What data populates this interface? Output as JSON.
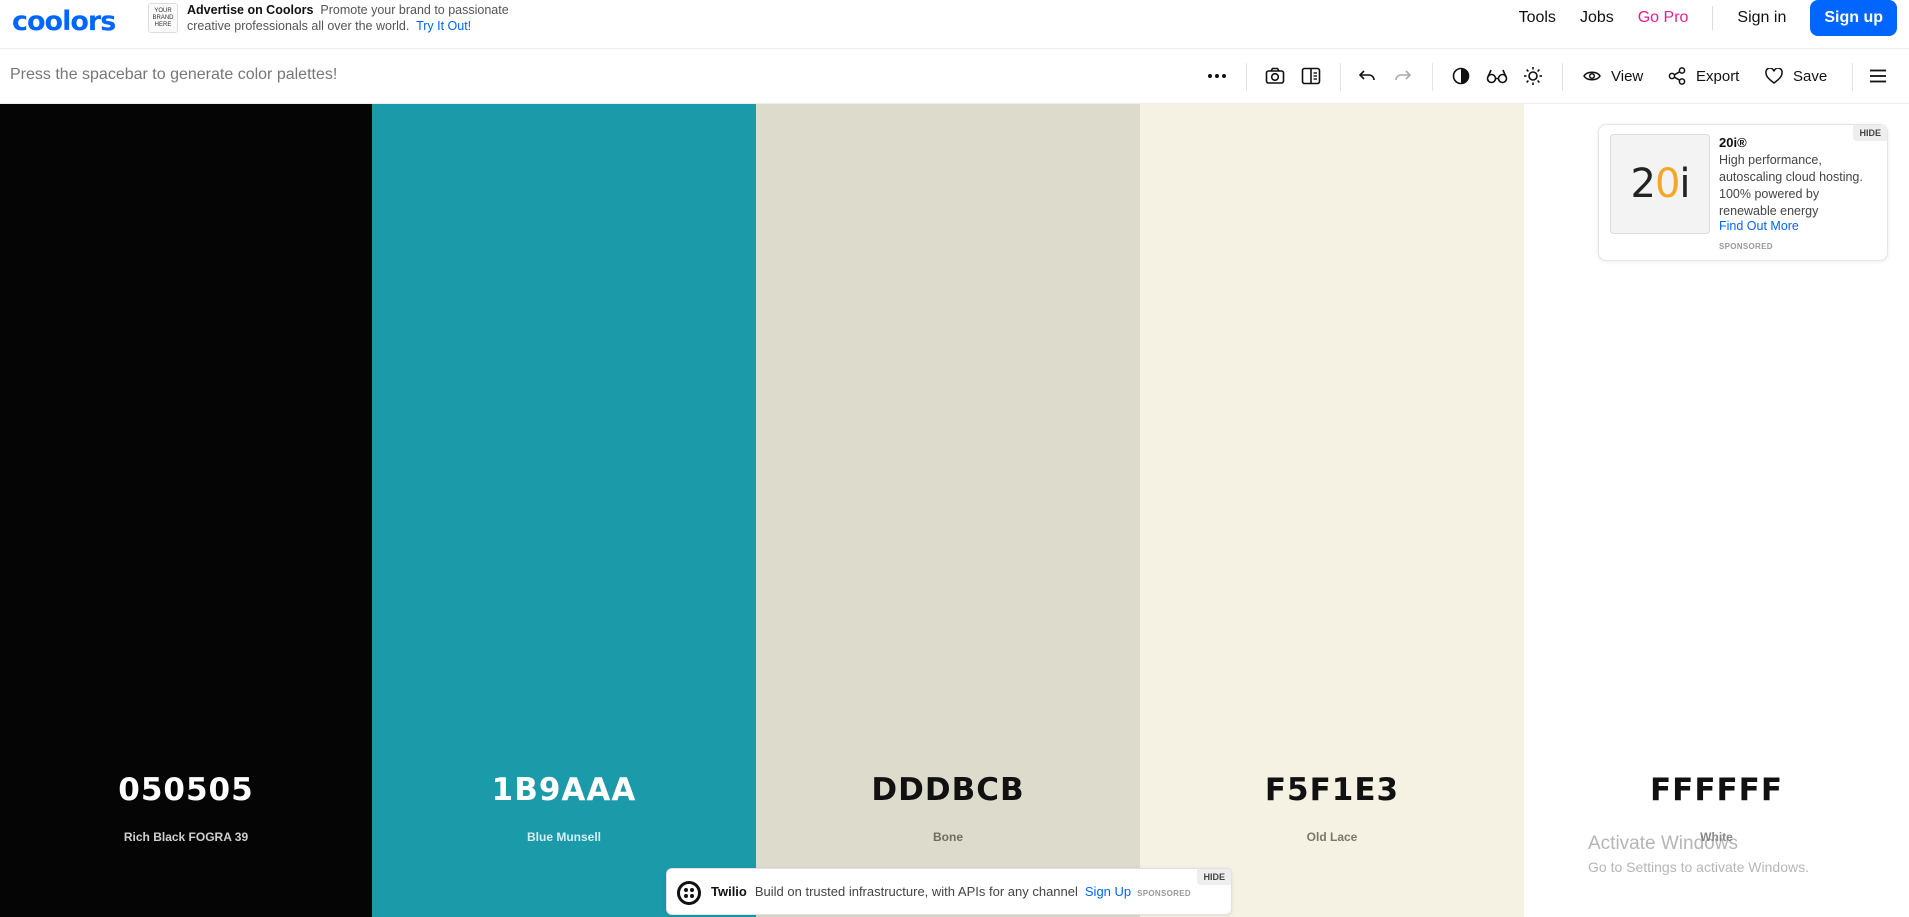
{
  "app": {
    "logo": "coolors"
  },
  "ad_top": {
    "thumb_text": "YOUR BRAND HERE",
    "title": "Advertise on Coolors",
    "body": "Promote your brand to passionate creative professionals all over the world.",
    "cta": "Try It Out!"
  },
  "nav": {
    "tools": "Tools",
    "jobs": "Jobs",
    "go_pro": "Go Pro",
    "sign_in": "Sign in",
    "sign_up": "Sign up",
    "pro_color": "#e91e8c",
    "accent": "#0066ff"
  },
  "toolbar": {
    "hint": "Press the spacebar to generate color palettes!",
    "icons": [
      "more-icon",
      "camera-icon",
      "layout-icon",
      "undo-icon",
      "redo-icon",
      "contrast-icon",
      "glasses-icon",
      "sun-icon",
      "menu-icon"
    ],
    "view": "View",
    "export": "Export",
    "save": "Save"
  },
  "palette": [
    {
      "hex": "050505",
      "name": "Rich Black FOGRA 39",
      "color": "#050505",
      "text_color": "#ffffff",
      "name_color": "#cfcfcf"
    },
    {
      "hex": "1B9AAA",
      "name": "Blue Munsell",
      "color": "#1B9AAA",
      "text_color": "#ffffff",
      "name_color": "#d6eef1"
    },
    {
      "hex": "DDDBCB",
      "name": "Bone",
      "color": "#DDDBCB",
      "text_color": "#111111",
      "name_color": "#6f6d63"
    },
    {
      "hex": "F5F1E3",
      "name": "Old Lace",
      "color": "#F5F1E3",
      "text_color": "#111111",
      "name_color": "#7a776d"
    },
    {
      "hex": "FFFFFF",
      "name": "White",
      "color": "#FFFFFF",
      "text_color": "#111111",
      "name_color": "#888888"
    }
  ],
  "side_ad": {
    "hide": "HIDE",
    "logo": "20i",
    "brand": "20i®",
    "desc": "High performance, autoscaling cloud hosting. 100% powered by renewable energy",
    "cta": "Find Out More",
    "sponsored": "SPONSORED"
  },
  "bottom_ad": {
    "hide": "HIDE",
    "brand": "Twilio",
    "body": "Build on trusted infrastructure, with APIs for any channel",
    "cta": "Sign Up",
    "sponsored": "SPONSORED"
  },
  "watermark": {
    "line1": "Activate Windows",
    "line2": "Go to Settings to activate Windows."
  }
}
